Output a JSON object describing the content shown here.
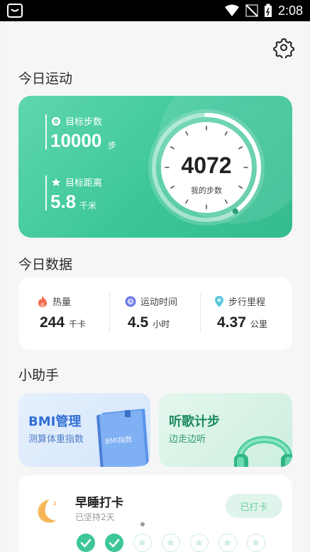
{
  "status_bar": {
    "time": "2:08"
  },
  "sections": {
    "today_sport": "今日运动",
    "today_data": "今日数据",
    "assistant": "小助手"
  },
  "hero": {
    "target_steps_label": "目标步数",
    "target_steps_value": "10000",
    "target_steps_unit": "步",
    "target_distance_label": "目标距离",
    "target_distance_value": "5.8",
    "target_distance_unit": "千米",
    "steps": "4072",
    "steps_caption": "我的步数",
    "progress_fraction": 0.407
  },
  "stats": [
    {
      "label": "热量",
      "value": "244",
      "unit": "千卡",
      "icon": "flame-icon"
    },
    {
      "label": "运动时间",
      "value": "4.5",
      "unit": "小时",
      "icon": "clock-icon"
    },
    {
      "label": "步行里程",
      "value": "4.37",
      "unit": "公里",
      "icon": "location-pin-icon"
    }
  ],
  "tools": {
    "bmi": {
      "title": "BMI管理",
      "subtitle": "测算体重指数",
      "book_text": "BMI指数"
    },
    "music": {
      "title": "听歌计步",
      "subtitle": "边走边听"
    }
  },
  "checkin": {
    "title": "早睡打卡",
    "subtitle": "已坚持2天",
    "button": "已打卡",
    "days_done": 2,
    "days_total": 7
  },
  "colors": {
    "accent": "#3cc69a",
    "accent_light": "#dff4ea"
  }
}
